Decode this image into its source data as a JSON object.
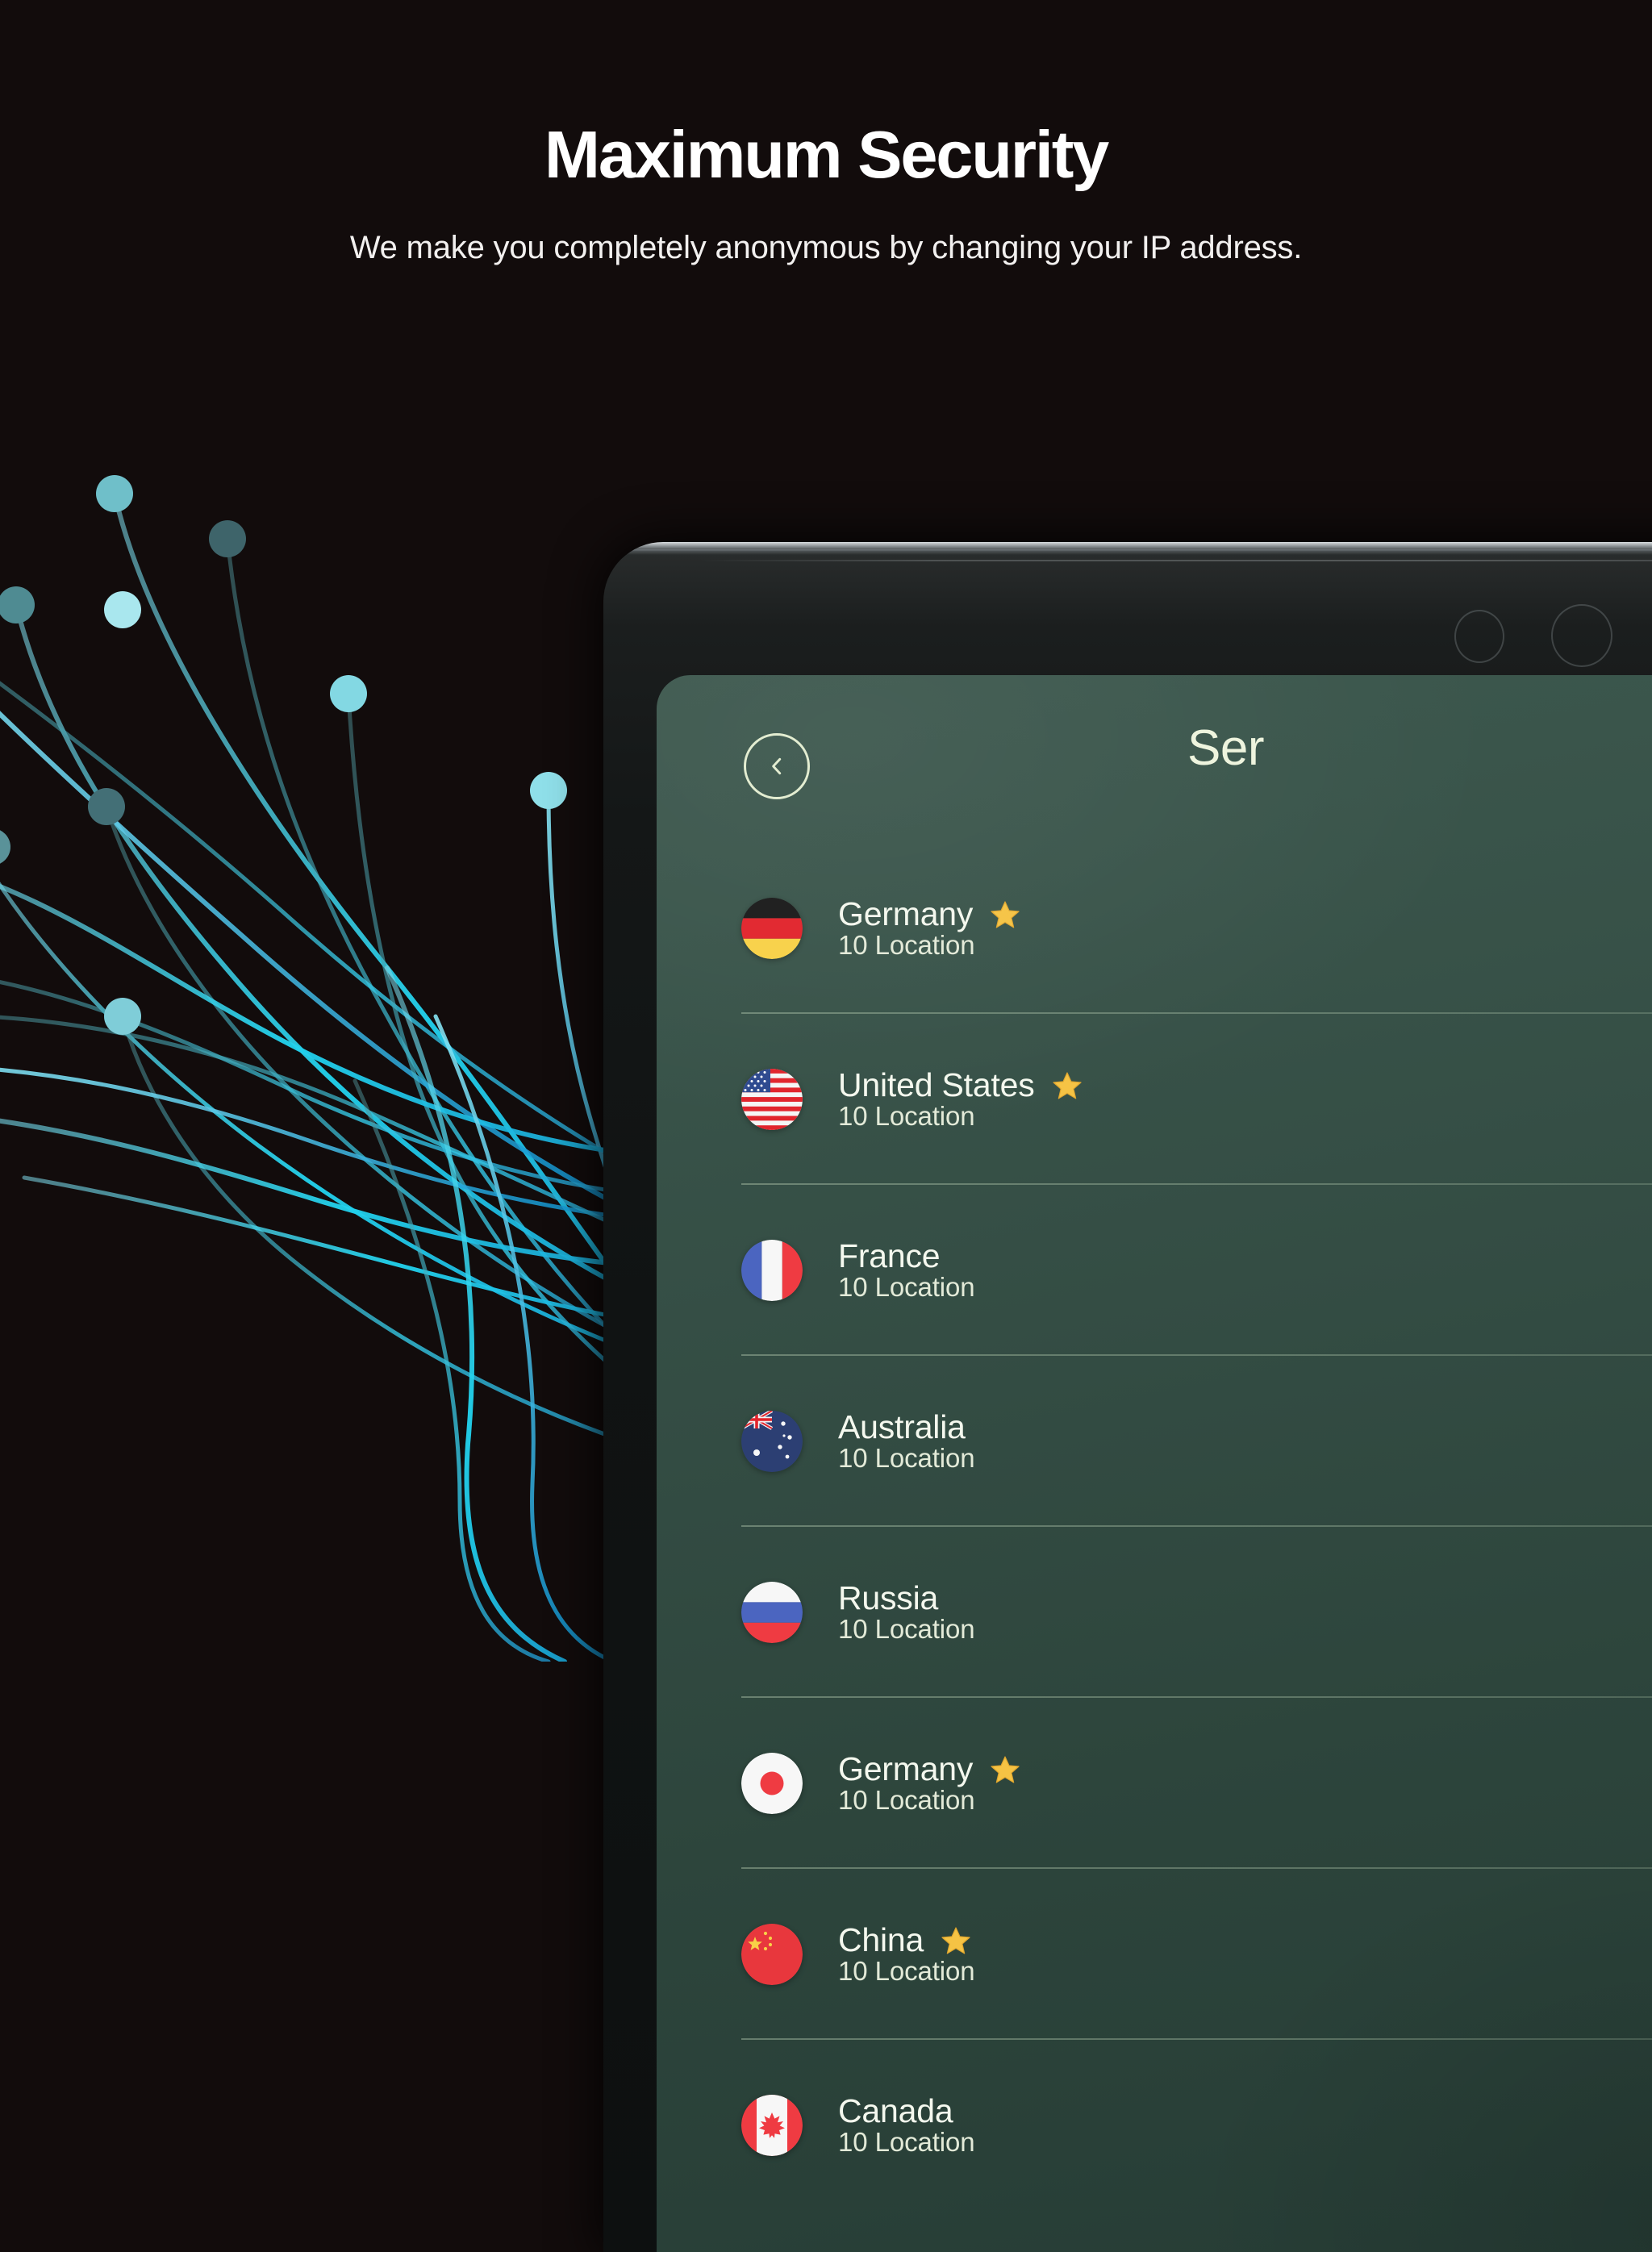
{
  "hero": {
    "title": "Maximum Security",
    "subtitle": "We make you completely anonymous by changing your IP address."
  },
  "colors": {
    "page_background": "#120c0c",
    "hero_title": "#ffffff",
    "hero_subtitle": "#f2f0ef",
    "screen_green_top": "#3d584e",
    "screen_green_bottom": "#263c35",
    "device_bezel": "#101313",
    "accent_text": "#eef4dd",
    "row_separator": "#bad0b4",
    "star": "#f5c344",
    "fiber_cyan": "#22d3ee"
  },
  "device": {
    "type": "tablet",
    "bezel_sensors": [
      "proximity-sensor",
      "ambient-light-sensor"
    ],
    "camera": "front-camera-lens"
  },
  "app": {
    "back_button_icon": "chevron-left-icon",
    "title": "Ser",
    "title_full": "Servers"
  },
  "servers": [
    {
      "name": "Germany",
      "locations": "10 Location",
      "flag": "de",
      "starred": true
    },
    {
      "name": "United States",
      "locations": "10 Location",
      "flag": "us",
      "starred": true
    },
    {
      "name": "France",
      "locations": "10 Location",
      "flag": "fr",
      "starred": false
    },
    {
      "name": "Australia",
      "locations": "10 Location",
      "flag": "au",
      "starred": false
    },
    {
      "name": "Russia",
      "locations": "10 Location",
      "flag": "ru",
      "starred": false
    },
    {
      "name": "Germany",
      "locations": "10 Location",
      "flag": "jp",
      "starred": true
    },
    {
      "name": "China",
      "locations": "10 Location",
      "flag": "cn",
      "starred": true
    },
    {
      "name": "Canada",
      "locations": "10 Location",
      "flag": "ca",
      "starred": false
    }
  ],
  "decoration": {
    "name": "fiber-optic-lines-graphic",
    "node_count": 10
  }
}
